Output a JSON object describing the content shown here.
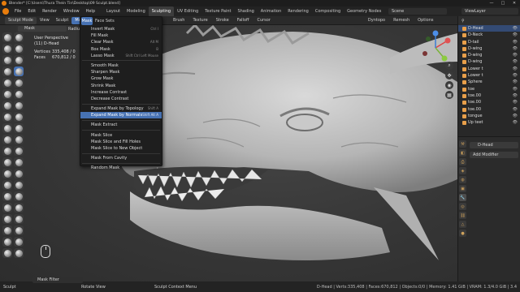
{
  "window": {
    "title": "Blender* [C:\\Users\\Thura Thein Tin\\Desktop\\09 Sculpt.blend]",
    "controls": [
      "—",
      "□",
      "✕"
    ]
  },
  "topmenu": [
    "File",
    "Edit",
    "Render",
    "Window",
    "Help"
  ],
  "workspaces": [
    "Layout",
    "Modeling",
    "Sculpting",
    "UV Editing",
    "Texture Paint",
    "Shading",
    "Animation",
    "Rendering",
    "Compositing",
    "Geometry Nodes"
  ],
  "active_workspace_index": 2,
  "scene_label": "Scene",
  "viewlayer_label": "ViewLayer",
  "header": {
    "mode": "Sculpt Mode",
    "menus": [
      "View",
      "Sculpt",
      "Mask",
      "Face Sets"
    ],
    "right_menus": [
      "Brush",
      "Texture",
      "Stroke",
      "Falloff",
      "Cursor"
    ],
    "options": [
      "Dyntopo",
      "Remesh",
      "Options"
    ]
  },
  "tool_header": {
    "tool": "Mask",
    "radius_label": "Radiu"
  },
  "viewport_info": {
    "view": "User Perspective",
    "object": "(11) D-Head",
    "rows": [
      {
        "label": "Vertices",
        "value": "335,408 / 0"
      },
      {
        "label": "Faces",
        "value": "670,812 / 0"
      }
    ]
  },
  "mask_menu": [
    {
      "label": "Invert Mask",
      "shortcut": "Ctrl I"
    },
    {
      "label": "Fill Mask",
      "shortcut": ""
    },
    {
      "label": "Clear Mask",
      "shortcut": "Alt M"
    },
    {
      "label": "Box Mask",
      "shortcut": "B"
    },
    {
      "label": "Lasso Mask",
      "shortcut": "Shift Ctrl Left Mouse"
    },
    {
      "sep": true
    },
    {
      "label": "Smooth Mask",
      "shortcut": ""
    },
    {
      "label": "Sharpen Mask",
      "shortcut": ""
    },
    {
      "label": "Grow Mask",
      "shortcut": ""
    },
    {
      "label": "Shrink Mask",
      "shortcut": ""
    },
    {
      "label": "Increase Contrast",
      "shortcut": ""
    },
    {
      "label": "Decrease Contrast",
      "shortcut": ""
    },
    {
      "sep": true
    },
    {
      "label": "Expand Mask by Topology",
      "shortcut": "Shift A"
    },
    {
      "label": "Expand Mask by Normals",
      "shortcut": "Shift Alt A",
      "highlight": true
    },
    {
      "sep": true
    },
    {
      "label": "Mask Extract",
      "shortcut": ""
    },
    {
      "sep": true
    },
    {
      "label": "Mask Slice",
      "shortcut": ""
    },
    {
      "label": "Mask Slice and Fill Holes",
      "shortcut": ""
    },
    {
      "label": "Mask Slice to New Object",
      "shortcut": ""
    },
    {
      "sep": true
    },
    {
      "label": "Mask From Cavity",
      "shortcut": ""
    },
    {
      "sep": true
    },
    {
      "label": "Random Mask",
      "shortcut": "▸"
    }
  ],
  "outliner": [
    {
      "name": "D-Head",
      "selected": true
    },
    {
      "name": "D-Neck"
    },
    {
      "name": "D-tail"
    },
    {
      "name": "D-wing"
    },
    {
      "name": "D-wing"
    },
    {
      "name": "D-wing"
    },
    {
      "name": "Lower t"
    },
    {
      "name": "Lower t"
    },
    {
      "name": "Sphere"
    },
    {
      "name": "toe"
    },
    {
      "name": "toe.00"
    },
    {
      "name": "toe.00"
    },
    {
      "name": "toe.00"
    },
    {
      "name": "tongue"
    },
    {
      "name": "Up teet"
    }
  ],
  "properties": {
    "object_name": "D-Head",
    "add_modifier": "Add Modifier"
  },
  "statusbar": {
    "left": "Sculpt",
    "middle1": "Rotate View",
    "middle2": "Sculpt Context Menu",
    "right": "D-Head | Verts:335,408 | Faces:670,812 | Objects:0/0 | Memory: 1.41 GiB | VRAM: 1.3/4.0 GiB | 3.4"
  },
  "mask_filter": "Mask Filter",
  "colors": {
    "accent": "#4772b3",
    "brand": "#e87d0d"
  }
}
